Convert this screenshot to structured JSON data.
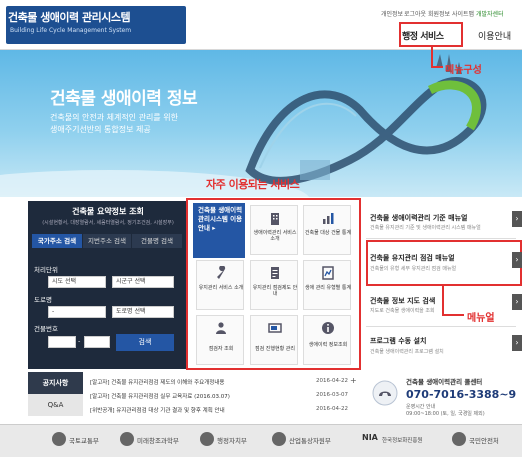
{
  "header": {
    "logo_title": "건축물 생애이력 관리시스템",
    "logo_subtitle": "Building Life Cycle Management System",
    "util_links": [
      "개인정보",
      "로그아웃",
      "회원정보",
      "사이트맵",
      "개발자센터"
    ],
    "nav": [
      "행정 서비스",
      "이용안내"
    ]
  },
  "annotations": {
    "menu": "메뉴구성",
    "frequent": "자주 이용되는 서비스",
    "menu2": "메뉴얼"
  },
  "hero": {
    "title": "건축물 생애이력 정보",
    "desc1": "건축물의 안전과 체계적인 관리를 위한",
    "desc2": "생애주기선반의 통합정보 제공"
  },
  "summary": {
    "title": "건축물 요약정보 조회",
    "subtitle": "(시설현황서, 대장열람서, 세움터열람서, 정기조건검, 시설장부)",
    "tabs": [
      "국가주소 검색",
      "지번주소 검색",
      "건물명 검색"
    ],
    "fields": {
      "region_label": "처리단위",
      "region_value": "시도 선택",
      "district_value": "시군구 선택",
      "road_label": "도로명",
      "road_value": "-",
      "road_name_value": "도로명 선택",
      "bldg_no_label": "건물번호",
      "bldg_no_value": "-"
    },
    "search_button": "검색"
  },
  "services": {
    "main": "건축물 생애이력 관리시스템 이용안내 ▸",
    "tiles": [
      {
        "label": "생애이력관리 서비스 소개",
        "icon": "building-icon"
      },
      {
        "label": "건축물 대상 건물 통계",
        "icon": "chart-icon"
      },
      {
        "label": "유지관리 서비스 소개",
        "icon": "wrench-icon"
      },
      {
        "label": "유지관리 점검제도 안내",
        "icon": "document-icon"
      },
      {
        "label": "생애 관리 유형별 통계",
        "icon": "stats-icon"
      },
      {
        "label": "점검자 조회",
        "icon": "person-icon"
      },
      {
        "label": "점검 진행현황 관리",
        "icon": "progress-icon"
      },
      {
        "label": "생애이력 정보조회",
        "icon": "info-icon"
      }
    ]
  },
  "right_links": [
    {
      "title": "건축물 생애이력관리 기준 매뉴얼",
      "desc": "건축물 유지관리 기준 및 생애이력관리 시스템 매뉴얼"
    },
    {
      "title": "건축물 유지관리 점검 매뉴얼",
      "desc": "건축물의 유형 세부 유지관리 점검 매뉴얼"
    },
    {
      "title": "건축물 정보 지도 검색",
      "desc": "지도로 건축물 생애이력을 조회"
    },
    {
      "title": "프로그램 수동 설치",
      "desc": "건축물 생애이력관리 프로그램 설치"
    }
  ],
  "notices": {
    "tabs": [
      "공지사항",
      "Q&A"
    ],
    "more": "+",
    "items": [
      {
        "text": "[알고자] 건축물 유지관리점검 제도의 이해와 주요개정내용",
        "date": "2016-04-22"
      },
      {
        "text": "[알고자] 건축물 유지관리점검 실무 교육자료 (2016.03.07)",
        "date": "2016-03-07"
      },
      {
        "text": "[위반공개] 유지관리점검 대상 기관 결과 및 향후 계획 안내",
        "date": "2016-04-22"
      }
    ]
  },
  "call_center": {
    "title": "건축물 생애이력관리 콜센터",
    "phone": "070-7016-3388~9",
    "hours1": "운영시간 안내",
    "hours2": "09:00~18:00 (토, 일, 국경일 제외)"
  },
  "footer": [
    "국토교통부",
    "미래창조과학부",
    "행정자치부",
    "산업통상자원부",
    "한국정보화진흥원",
    "국민안전처"
  ],
  "footer_nia": "NIA"
}
